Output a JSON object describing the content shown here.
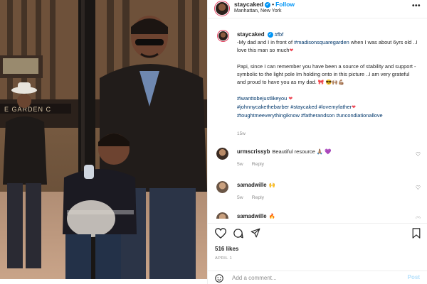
{
  "post": {
    "username": "staycaked",
    "verified": true,
    "follow_label": "Follow",
    "location": "Manhattan, New York",
    "more_icon": "more-horizontal-icon"
  },
  "caption": {
    "username": "staycaked",
    "tag_fbf": "#fbf",
    "line1_pre": "-My dad and I in front of ",
    "tag_msg": "#madisonsquaregarden",
    "line1_post": " when I was about 6yrs old ..I love this man so much",
    "para2": "Papi, since I can remember you have been a source of stability and support -symbolic to the light pole Im holding onto in this picture ..I am very grateful and proud to have you as my dad. ",
    "hashtags": [
      "#iwanttobejustlikeyou",
      "#johnnycakethebarber",
      "#staycaked",
      "#lovemyfather",
      "#toughtmeeverythingiknow",
      "#fatherandson",
      "#uncondiationallove"
    ],
    "time": "15w"
  },
  "comments": [
    {
      "username": "urmscrissyb",
      "text": "Beautiful resource 🙏🏽 💜",
      "time": "5w",
      "reply_label": "Reply"
    },
    {
      "username": "samadwille",
      "text": "🙌",
      "time": "5w",
      "reply_label": "Reply"
    },
    {
      "username": "samadwille",
      "text": "🔥",
      "time": "",
      "reply_label": ""
    }
  ],
  "actions": {
    "like_icon": "heart-icon",
    "comment_icon": "comment-icon",
    "share_icon": "share-icon",
    "save_icon": "bookmark-icon"
  },
  "likes_label": "516 likes",
  "date_label": "APRIL 1",
  "add_comment": {
    "placeholder": "Add a comment...",
    "post_label": "Post"
  },
  "colors": {
    "accent": "#0095f6",
    "heart": "#ed4956",
    "hashtag": "#00376b",
    "muted": "#8e8e8e",
    "divider": "#efefef"
  }
}
